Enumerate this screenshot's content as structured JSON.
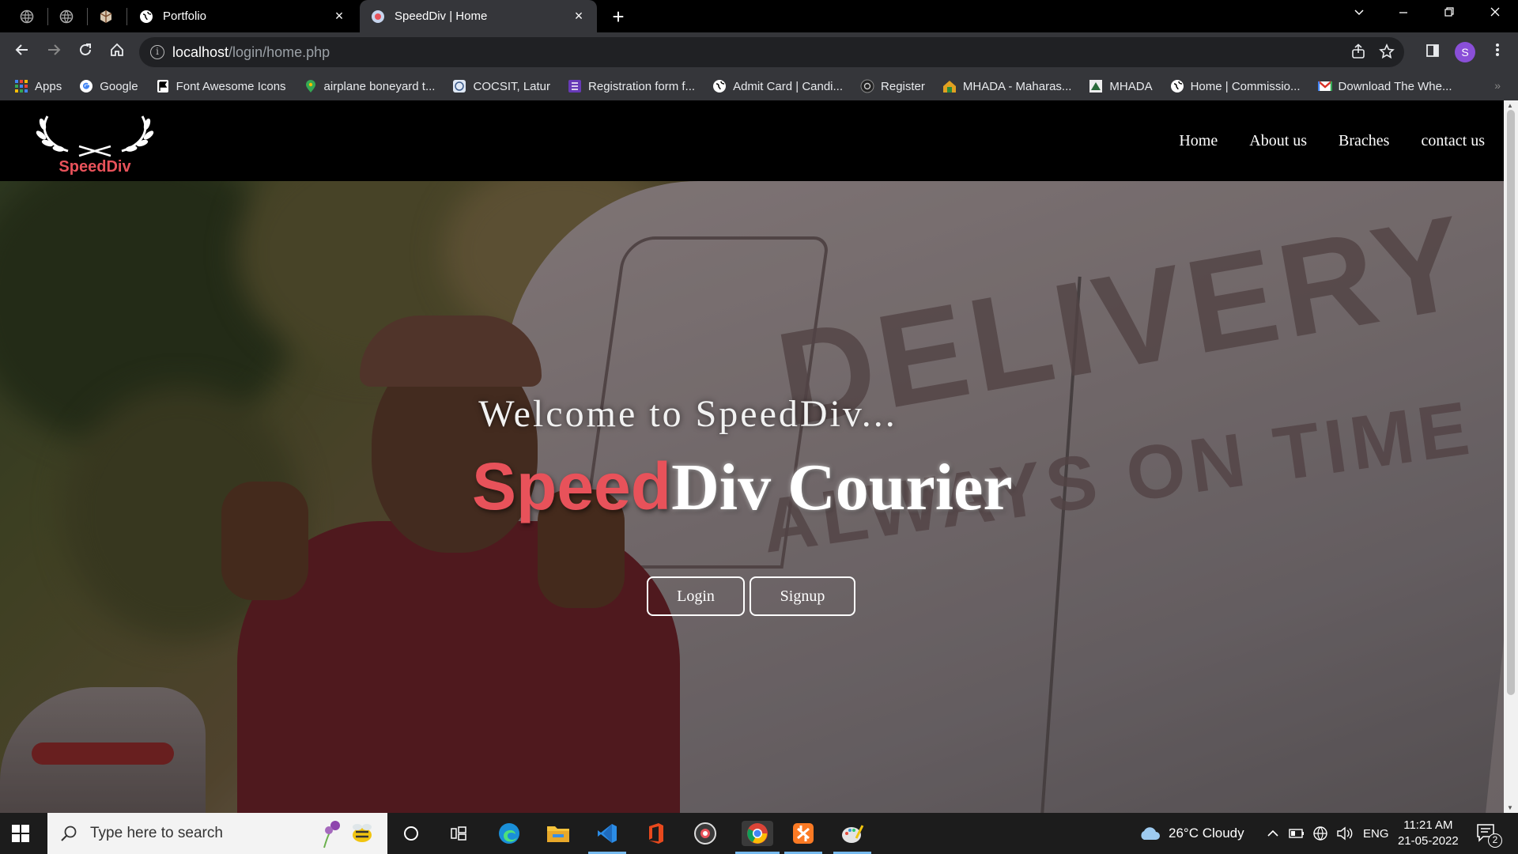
{
  "browser": {
    "tabs": [
      {
        "title": "Portfolio",
        "close": "×"
      },
      {
        "title": "SpeedDiv | Home",
        "close": "×"
      }
    ],
    "new_tab": "+",
    "url_host": "localhost",
    "url_path": "/login/home.php",
    "avatar": "S",
    "bookmarks": [
      {
        "label": "Apps",
        "icon": "apps-grid-icon",
        "color": "#4285f4"
      },
      {
        "label": "Google",
        "icon": "google-icon",
        "color": "#ea4335"
      },
      {
        "label": "Font Awesome Icons",
        "icon": "flag-icon",
        "color": "#ffffff"
      },
      {
        "label": "airplane boneyard t...",
        "icon": "map-pin-icon",
        "color": "#34a853"
      },
      {
        "label": "COCSIT, Latur",
        "icon": "college-icon",
        "color": "#9ab3d5"
      },
      {
        "label": "Registration form f...",
        "icon": "form-icon",
        "color": "#673ab7"
      },
      {
        "label": "Admit Card | Candi...",
        "icon": "globe-icon",
        "color": "#cccccc"
      },
      {
        "label": "Register",
        "icon": "register-icon",
        "color": "#444444"
      },
      {
        "label": "MHADA - Maharas...",
        "icon": "mhada-icon",
        "color": "#e0a020"
      },
      {
        "label": "MHADA",
        "icon": "mhada-logo-icon",
        "color": "#cccccc"
      },
      {
        "label": "Home | Commissio...",
        "icon": "globe-icon",
        "color": "#cccccc"
      },
      {
        "label": "Download The Whe...",
        "icon": "gmail-icon",
        "color": "#d93025"
      }
    ],
    "bookmarks_more": "»"
  },
  "site": {
    "logo_text": "SpeedDiv",
    "nav": [
      "Home",
      "About us",
      "Braches",
      "contact us"
    ],
    "welcome": "Welcome to SpeedDiv...",
    "brand_speed": "Speed",
    "brand_rest": "Div Courier",
    "login_label": "Login",
    "signup_label": "Signup",
    "van_text_1": "DELIVERY",
    "van_text_2": "ALWAYS ON TIME"
  },
  "taskbar": {
    "search_placeholder": "Type here to search",
    "weather": "26°C  Cloudy",
    "language": "ENG",
    "time": "11:21 AM",
    "date": "21-05-2022",
    "notifications": "2"
  },
  "colors": {
    "accent_red": "#e8525a",
    "nav_bg": "#000000",
    "chrome_toolbar": "#35363a"
  }
}
